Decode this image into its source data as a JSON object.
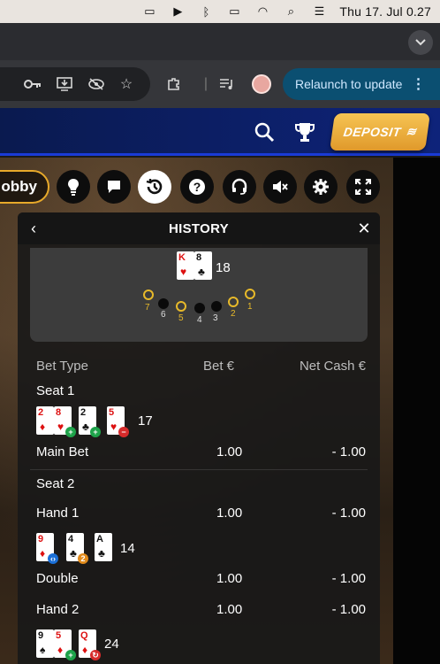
{
  "menubar": {
    "clock": "Thu 17. Jul  0.27"
  },
  "toolbar": {
    "relaunch_label": "Relaunch to update"
  },
  "header": {
    "deposit_label": "DEPOSIT"
  },
  "controls": {
    "lobby_label": "obby"
  },
  "history": {
    "title": "HISTORY",
    "dealer": {
      "cards": [
        {
          "rank": "K",
          "suit": "♥",
          "color": "red"
        },
        {
          "rank": "8",
          "suit": "♣",
          "color": "black"
        }
      ],
      "total": "18",
      "seats_left_to_right": [
        "7",
        "6",
        "5",
        "4",
        "3",
        "2",
        "1"
      ]
    },
    "columns": [
      "Bet Type",
      "Bet €",
      "Net Cash €"
    ],
    "seat1": {
      "label": "Seat 1",
      "cards": [
        {
          "rank": "2",
          "suit": "♦",
          "color": "red"
        },
        {
          "rank": "8",
          "suit": "♥",
          "color": "red"
        },
        {
          "rank": "2",
          "suit": "♣",
          "color": "black"
        },
        {
          "rank": "5",
          "suit": "♥",
          "color": "red"
        }
      ],
      "total": "17",
      "main_bet_label": "Main Bet",
      "main_bet": "1.00",
      "main_net": "- 1.00"
    },
    "seat2": {
      "label": "Seat 2",
      "hand1_label": "Hand 1",
      "hand1_bet": "1.00",
      "hand1_net": "- 1.00",
      "hand1_cards": [
        {
          "rank": "9",
          "suit": "♦",
          "color": "red"
        },
        {
          "rank": "4",
          "suit": "♣",
          "color": "black"
        },
        {
          "rank": "A",
          "suit": "♣",
          "color": "black"
        }
      ],
      "hand1_total": "14",
      "double_label": "Double",
      "double_bet": "1.00",
      "double_net": "- 1.00",
      "hand2_label": "Hand 2",
      "hand2_bet": "1.00",
      "hand2_net": "- 1.00",
      "hand2_cards": [
        {
          "rank": "9",
          "suit": "♠",
          "color": "black"
        },
        {
          "rank": "5",
          "suit": "♦",
          "color": "red"
        },
        {
          "rank": "Q",
          "suit": "♦",
          "color": "red"
        }
      ],
      "hand2_total": "24"
    }
  }
}
